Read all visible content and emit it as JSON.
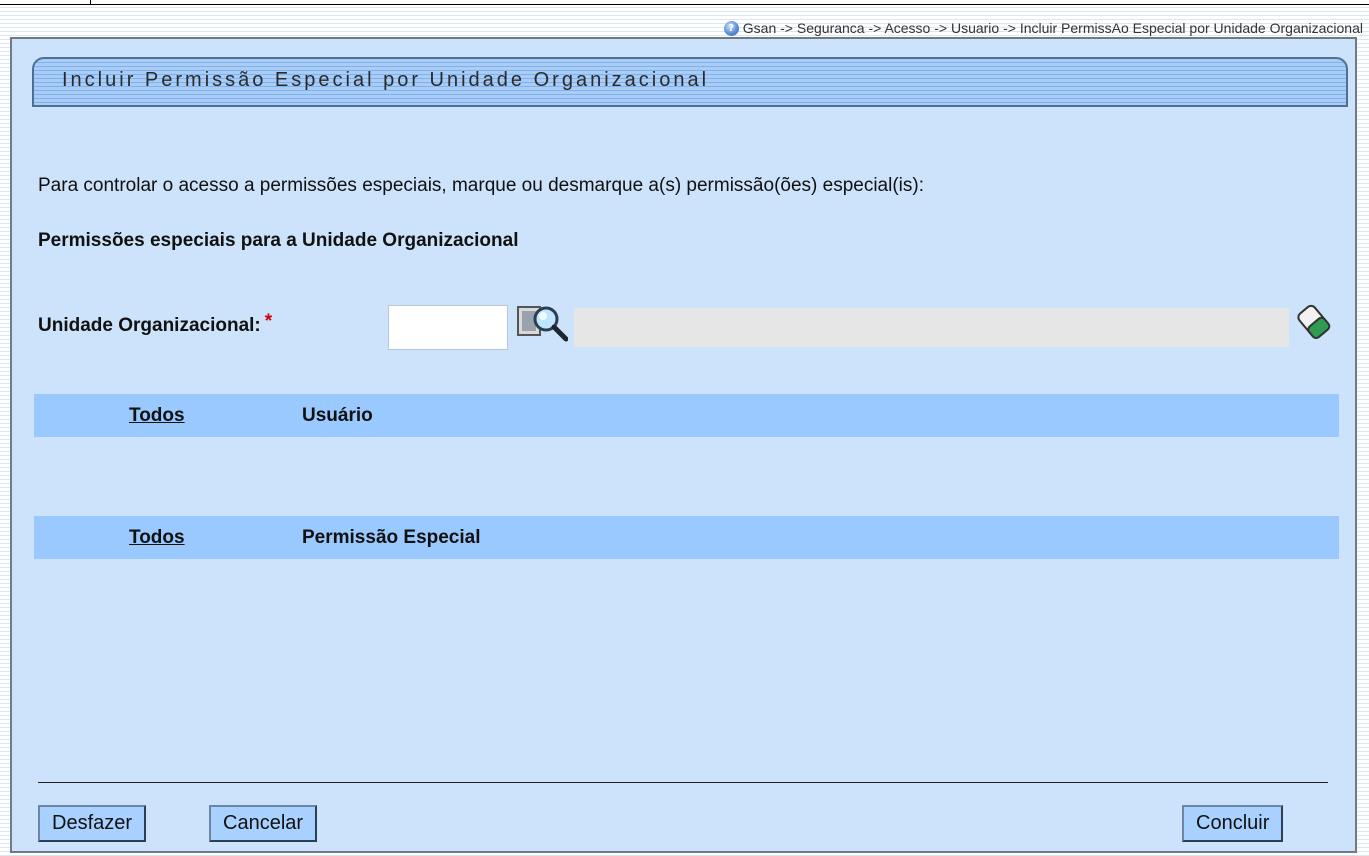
{
  "breadcrumb": {
    "text": "Gsan -> Seguranca -> Acesso -> Usuario -> Incluir PermissAo Especial por Unidade Organizacional",
    "icon": "help-icon"
  },
  "form": {
    "title": "Incluir Permissão Especial por Unidade Organizacional",
    "instruction": "Para controlar o acesso a permissões especiais, marque ou desmarque a(s) permissão(ões) especial(is):",
    "subtitle": "Permissões especiais para a Unidade Organizacional",
    "unit_label": "Unidade Organizacional:",
    "required_mark": "*",
    "unit_code_value": "",
    "unit_description_value": ""
  },
  "users_table": {
    "select_all": "Todos",
    "column": "Usuário",
    "rows": []
  },
  "permissions_table": {
    "select_all": "Todos",
    "column": "Permissão Especial",
    "rows": []
  },
  "buttons": {
    "undo": "Desfazer",
    "cancel": "Cancelar",
    "finish": "Concluir"
  },
  "colors": {
    "panel_bg": "#cde3fb",
    "header_row_bg": "#99c9ff",
    "button_bg": "#a9d1ff",
    "required": "#d00000"
  }
}
